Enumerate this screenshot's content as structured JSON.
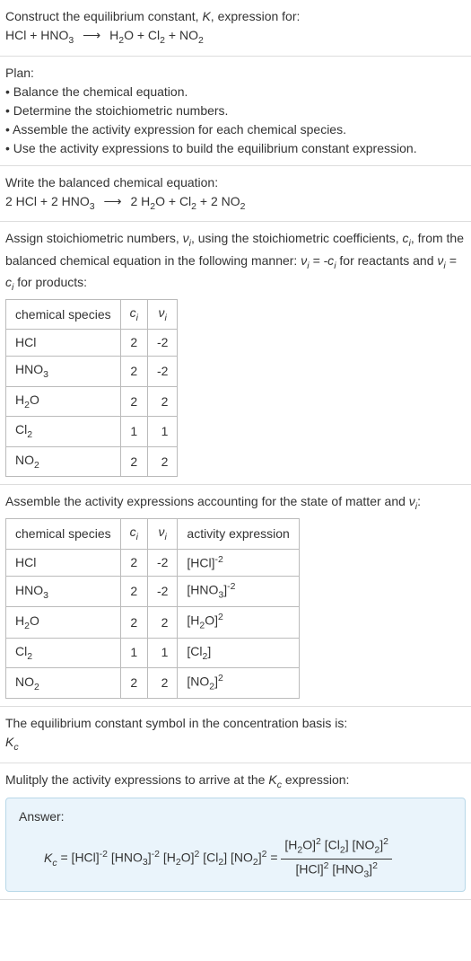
{
  "sec1": {
    "line1": "Construct the equilibrium constant, ",
    "K": "K",
    "line1b": ", expression for:",
    "eq_lhs": "HCl + HNO",
    "eq_lhs_sub": "3",
    "eq_rhs_a": "H",
    "eq_rhs_a_sub": "2",
    "eq_rhs_b": "O + Cl",
    "eq_rhs_b_sub": "2",
    "eq_rhs_c": " + NO",
    "eq_rhs_c_sub": "2"
  },
  "sec2": {
    "title": "Plan:",
    "b1": "Balance the chemical equation.",
    "b2": "Determine the stoichiometric numbers.",
    "b3": "Assemble the activity expression for each chemical species.",
    "b4": "Use the activity expressions to build the equilibrium constant expression."
  },
  "sec3": {
    "title": "Write the balanced chemical equation:"
  },
  "sec4": {
    "l1a": "Assign stoichiometric numbers, ",
    "l1b": ", using the stoichiometric coefficients, ",
    "l1c": ", from the balanced chemical equation in the following manner: ",
    "l1d": " for reactants and ",
    "l1e": " for products:",
    "th1": "chemical species",
    "rows": [
      {
        "sp_a": "HCl",
        "sp_sub": "",
        "c": "2",
        "v": "-2"
      },
      {
        "sp_a": "HNO",
        "sp_sub": "3",
        "c": "2",
        "v": "-2"
      },
      {
        "sp_a": "H",
        "sp_sub": "2",
        "sp_b": "O",
        "c": "2",
        "v": "2"
      },
      {
        "sp_a": "Cl",
        "sp_sub": "2",
        "c": "1",
        "v": "1"
      },
      {
        "sp_a": "NO",
        "sp_sub": "2",
        "c": "2",
        "v": "2"
      }
    ]
  },
  "sec5": {
    "l1": "Assemble the activity expressions accounting for the state of matter and ",
    "l1b": ":",
    "th4": "activity expression"
  },
  "sec6": {
    "l1": "The equilibrium constant symbol in the concentration basis is:"
  },
  "sec7": {
    "l1": "Mulitply the activity expressions to arrive at the ",
    "l1b": " expression:",
    "answer": "Answer:"
  },
  "chart_data": {
    "type": "table",
    "tables": [
      {
        "title": "Stoichiometric numbers",
        "columns": [
          "chemical species",
          "c_i",
          "v_i"
        ],
        "rows": [
          [
            "HCl",
            2,
            -2
          ],
          [
            "HNO3",
            2,
            -2
          ],
          [
            "H2O",
            2,
            2
          ],
          [
            "Cl2",
            1,
            1
          ],
          [
            "NO2",
            2,
            2
          ]
        ]
      },
      {
        "title": "Activity expressions",
        "columns": [
          "chemical species",
          "c_i",
          "v_i",
          "activity expression"
        ],
        "rows": [
          [
            "HCl",
            2,
            -2,
            "[HCl]^-2"
          ],
          [
            "HNO3",
            2,
            -2,
            "[HNO3]^-2"
          ],
          [
            "H2O",
            2,
            2,
            "[H2O]^2"
          ],
          [
            "Cl2",
            1,
            1,
            "[Cl2]"
          ],
          [
            "NO2",
            2,
            2,
            "[NO2]^2"
          ]
        ]
      }
    ],
    "balanced_equation": "2 HCl + 2 HNO3 -> 2 H2O + Cl2 + 2 NO2",
    "Kc_expression": "Kc = [HCl]^-2 [HNO3]^-2 [H2O]^2 [Cl2] [NO2]^2 = ([H2O]^2 [Cl2] [NO2]^2) / ([HCl]^2 [HNO3]^2)"
  }
}
